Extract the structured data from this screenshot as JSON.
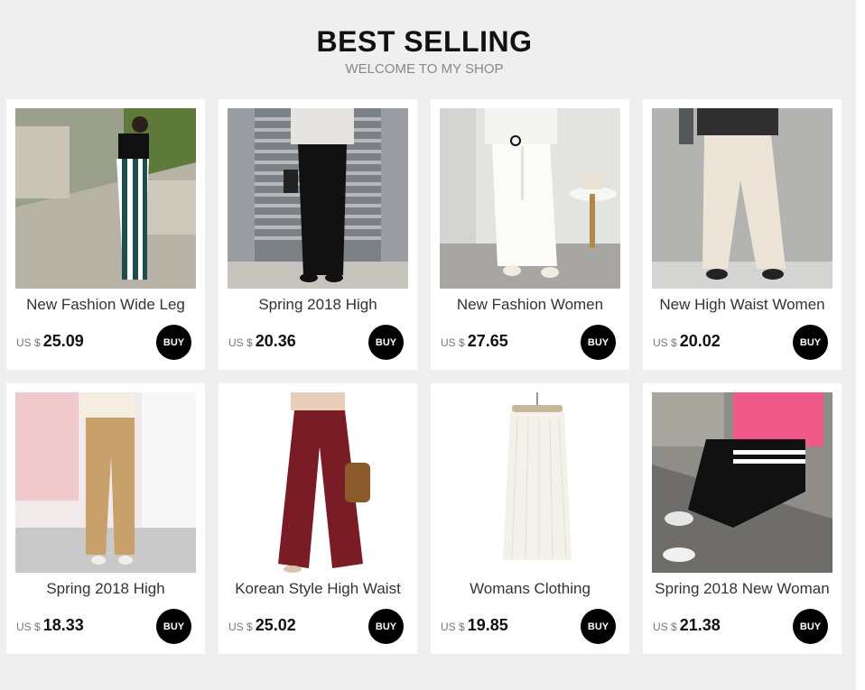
{
  "header": {
    "title": "BEST SELLING",
    "subtitle": "WELCOME TO MY SHOP"
  },
  "currency_label": "US $",
  "buy_label": "BUY",
  "products": [
    {
      "name": "New Fashion Wide Leg",
      "price": "25.09"
    },
    {
      "name": "Spring 2018 High",
      "price": "20.36"
    },
    {
      "name": "New Fashion Women",
      "price": "27.65"
    },
    {
      "name": "New High Waist Women",
      "price": "20.02"
    },
    {
      "name": "Spring 2018 High",
      "price": "18.33"
    },
    {
      "name": "Korean Style High Waist",
      "price": "25.02"
    },
    {
      "name": "Womans Clothing",
      "price": "19.85"
    },
    {
      "name": "Spring 2018 New Woman",
      "price": "21.38"
    }
  ]
}
